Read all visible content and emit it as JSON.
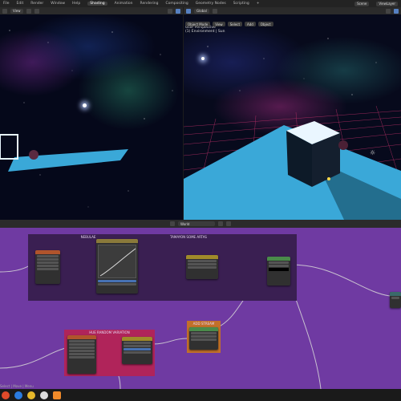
{
  "menu": {
    "items": [
      "File",
      "Edit",
      "Render",
      "Window",
      "Help",
      "Shading",
      "Animation",
      "Rendering",
      "Compositing",
      "Geometry Nodes",
      "Scripting",
      "+"
    ],
    "active_index": 5,
    "scene_label": "Scene",
    "layer_label": "ViewLayer"
  },
  "left_viewport": {
    "view_label": "View",
    "mode_label": "Object Mode"
  },
  "right_viewport": {
    "mode_label": "Object Mode",
    "menus": [
      "View",
      "Select",
      "Add",
      "Object"
    ],
    "overlay_line1": "User Perspective",
    "overlay_line2": "(1) Environment | Sun",
    "transform_label": "Global"
  },
  "node_editor": {
    "world_label": "World",
    "frames": [
      {
        "label": "NEBULAE",
        "color": "#3a1f52"
      },
      {
        "label": "TAMAYON SOME ARTAS",
        "color": "#3a1f52"
      },
      {
        "label": "HUE RANDOM VARIATION",
        "color": "#b0245a"
      },
      {
        "label": "ADD STREAM",
        "color": "#c2702a"
      }
    ]
  },
  "status": {
    "text": "Select | Move | Menu"
  },
  "colors": {
    "node_bg": "#6f3aa2",
    "ground": "#3aa8d8",
    "accent": "#4772b3"
  }
}
